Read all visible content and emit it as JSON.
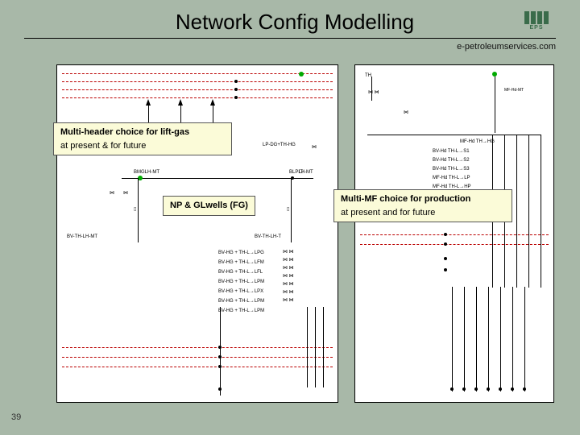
{
  "header": {
    "title": "Network Config Modelling",
    "logo_label": "EPS",
    "url": "e-petroleumservices.com"
  },
  "callouts": {
    "liftgas": {
      "line1": "Multi-header choice for lift-gas",
      "line2": "at present & for future"
    },
    "npgl": {
      "line1": "NP & GLwells (FG)"
    },
    "multimf": {
      "line1": "Multi-MF choice for production",
      "line2": "at present and for future"
    }
  },
  "page_number": "39",
  "left_panel_labels": {
    "a": "LP-DG+TH-HG",
    "b": "BLPLH-MT",
    "c": "BMGLH-MT",
    "d": "BV-TH-LH-MT",
    "e": "BV-TH-LH-T"
  },
  "right_panel_labels": {
    "top": "TH",
    "mid": "MF-Hd TH→HG",
    "rows": [
      "BV-HG + TH-L→LPG",
      "BV-HG + TH-L→LFM",
      "BV-HG + TH-L→LFL",
      "BV-HG + TH-L→LPM",
      "BV-HG + TH-L→LPX",
      "BV-HG + TH-L→LPM",
      "BV-HG + TH-L→LPM"
    ]
  }
}
